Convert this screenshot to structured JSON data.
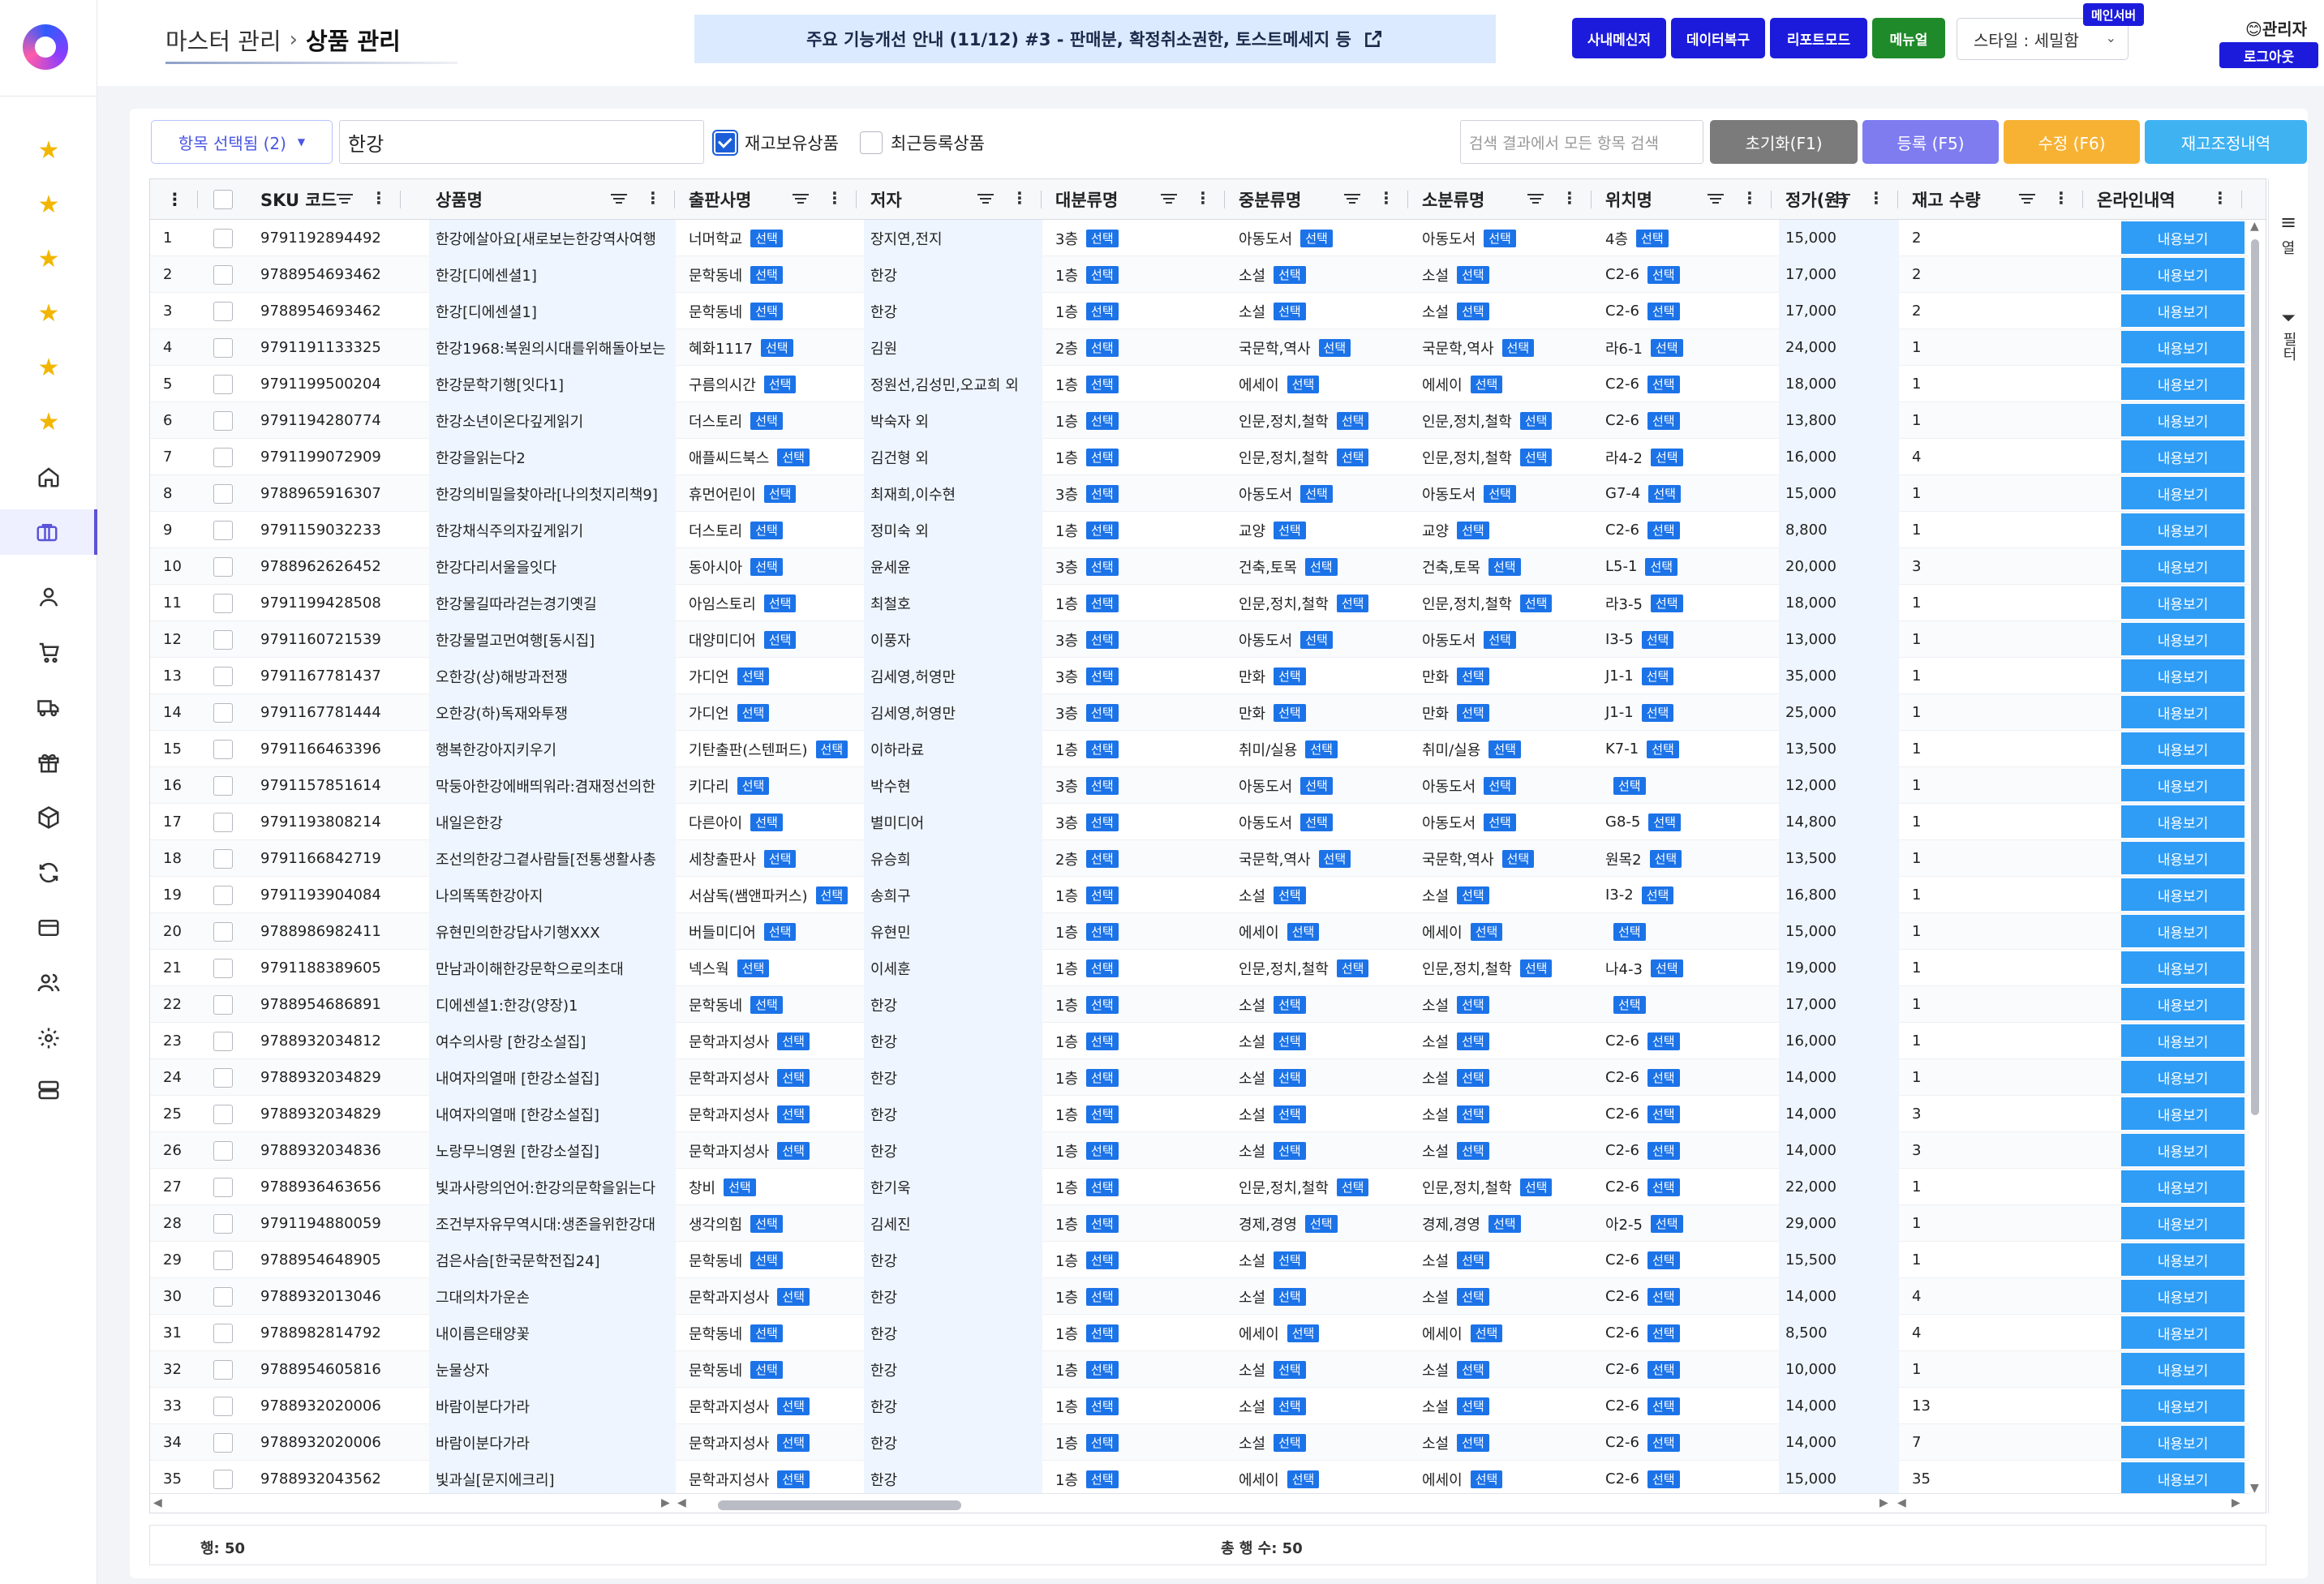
{
  "header": {
    "breadcrumb_parent": "마스터 관리",
    "breadcrumb_current": "상품 관리",
    "notice": "주요 기능개선 안내 (11/12) #3 - 판매분, 확정취소권한, 토스트메세지 등",
    "buttons": {
      "messenger": "사내메신저",
      "data_restore": "데이터복구",
      "report_mode": "리포트모드",
      "manual": "메뉴얼"
    },
    "style_select": "스타일 : 세밀함",
    "server_badge": "메인서버",
    "user": "😊관리자",
    "logout": "로그아웃"
  },
  "toolbar": {
    "column_select": "항목 선택됨 (2)",
    "search_value": "한강",
    "in_stock_label": "재고보유상품",
    "in_stock_checked": true,
    "recent_label": "최근등록상품",
    "recent_checked": false,
    "search_all_placeholder": "검색 결과에서 모든 항목 검색",
    "reset": "초기화(F1)",
    "register": "등록 (F5)",
    "edit": "수정 (F6)",
    "stock_history": "재고조정내역"
  },
  "colors": {
    "reset": "#7b7b7b",
    "register": "#7f7cf0",
    "edit": "#f7b234",
    "stock_history": "#3fb2f2",
    "select_badge": "#1c73e8",
    "view_button": "#2f9df5"
  },
  "columns": [
    "SKU 코드",
    "상품명",
    "출판사명",
    "저자",
    "대분류명",
    "중분류명",
    "소분류명",
    "위치명",
    "정가(원)",
    "재고 수량",
    "온라인내역"
  ],
  "select_label": "선택",
  "view_label": "내용보기",
  "rows": [
    [
      "1",
      "9791192894492",
      "한강에살아요[새로보는한강역사여행",
      "너머학교",
      "장지연,전지",
      "3층",
      "아동도서",
      "아동도서",
      "4층",
      "15,000",
      "2"
    ],
    [
      "2",
      "9788954693462",
      "한강[디에센셜1]",
      "문학동네",
      "한강",
      "1층",
      "소설",
      "소설",
      "C2-6",
      "17,000",
      "2"
    ],
    [
      "3",
      "9788954693462",
      "한강[디에센셜1]",
      "문학동네",
      "한강",
      "1층",
      "소설",
      "소설",
      "C2-6",
      "17,000",
      "2"
    ],
    [
      "4",
      "9791191133325",
      "한강1968:복원의시대를위해돌아보는",
      "혜화1117",
      "김원",
      "2층",
      "국문학,역사",
      "국문학,역사",
      "라6-1",
      "24,000",
      "1"
    ],
    [
      "5",
      "9791199500204",
      "한강문학기행[잇다1]",
      "구름의시간",
      "정원선,김성민,오교희 외",
      "1층",
      "에세이",
      "에세이",
      "C2-6",
      "18,000",
      "1"
    ],
    [
      "6",
      "9791194280774",
      "한강소년이온다깊게읽기",
      "더스토리",
      "박숙자 외",
      "1층",
      "인문,정치,철학",
      "인문,정치,철학",
      "C2-6",
      "13,800",
      "1"
    ],
    [
      "7",
      "9791199072909",
      "한강을읽는다2",
      "애플씨드북스",
      "김건형 외",
      "1층",
      "인문,정치,철학",
      "인문,정치,철학",
      "라4-2",
      "16,000",
      "4"
    ],
    [
      "8",
      "9788965916307",
      "한강의비밀을찾아라[나의첫지리책9]",
      "휴먼어린이",
      "최재희,이수현",
      "3층",
      "아동도서",
      "아동도서",
      "G7-4",
      "15,000",
      "1"
    ],
    [
      "9",
      "9791159032233",
      "한강채식주의자깊게읽기",
      "더스토리",
      "정미숙 외",
      "1층",
      "교양",
      "교양",
      "C2-6",
      "8,800",
      "1"
    ],
    [
      "10",
      "9788962626452",
      "한강다리서울을잇다",
      "동아시아",
      "윤세윤",
      "3층",
      "건축,토목",
      "건축,토목",
      "L5-1",
      "20,000",
      "3"
    ],
    [
      "11",
      "9791199428508",
      "한강물길따라걷는경기옛길",
      "아임스토리",
      "최철호",
      "1층",
      "인문,정치,철학",
      "인문,정치,철학",
      "라3-5",
      "18,000",
      "1"
    ],
    [
      "12",
      "9791160721539",
      "한강물멀고먼여행[동시집]",
      "대양미디어",
      "이풍자",
      "3층",
      "아동도서",
      "아동도서",
      "I3-5",
      "13,000",
      "1"
    ],
    [
      "13",
      "9791167781437",
      "오한강(상)해방과전쟁",
      "가디언",
      "김세영,허영만",
      "3층",
      "만화",
      "만화",
      "J1-1",
      "35,000",
      "1"
    ],
    [
      "14",
      "9791167781444",
      "오한강(하)독재와투쟁",
      "가디언",
      "김세영,허영만",
      "3층",
      "만화",
      "만화",
      "J1-1",
      "25,000",
      "1"
    ],
    [
      "15",
      "9791166463396",
      "행복한강아지키우기",
      "기탄출판(스텐퍼드)",
      "이하라료",
      "1층",
      "취미/실용",
      "취미/실용",
      "K7-1",
      "13,500",
      "1"
    ],
    [
      "16",
      "9791157851614",
      "막둥아한강에배띄워라:겸재정선의한",
      "키다리",
      "박수현",
      "3층",
      "아동도서",
      "아동도서",
      "",
      "12,000",
      "1"
    ],
    [
      "17",
      "9791193808214",
      "내일은한강",
      "다른아이",
      "별미디어",
      "3층",
      "아동도서",
      "아동도서",
      "G8-5",
      "14,800",
      "1"
    ],
    [
      "18",
      "9791166842719",
      "조선의한강그곁사람들[전통생활사총",
      "세창출판사",
      "유승희",
      "2층",
      "국문학,역사",
      "국문학,역사",
      "원목2",
      "13,500",
      "1"
    ],
    [
      "19",
      "9791193904084",
      "나의똑똑한강아지",
      "서삼독(쌤앤파커스)",
      "송희구",
      "1층",
      "소설",
      "소설",
      "I3-2",
      "16,800",
      "1"
    ],
    [
      "20",
      "9788986982411",
      "유현민의한강답사기행XXX",
      "버들미디어",
      "유현민",
      "1층",
      "에세이",
      "에세이",
      "",
      "15,000",
      "1"
    ],
    [
      "21",
      "9791188389605",
      "만남과이해한강문학으로의초대",
      "넥스웍",
      "이세훈",
      "1층",
      "인문,정치,철학",
      "인문,정치,철학",
      "나4-3",
      "19,000",
      "1"
    ],
    [
      "22",
      "9788954686891",
      "디에센셜1:한강(양장)1",
      "문학동네",
      "한강",
      "1층",
      "소설",
      "소설",
      "",
      "17,000",
      "1"
    ],
    [
      "23",
      "9788932034812",
      "여수의사랑 [한강소설집]",
      "문학과지성사",
      "한강",
      "1층",
      "소설",
      "소설",
      "C2-6",
      "16,000",
      "1"
    ],
    [
      "24",
      "9788932034829",
      "내여자의열매 [한강소설집]",
      "문학과지성사",
      "한강",
      "1층",
      "소설",
      "소설",
      "C2-6",
      "14,000",
      "1"
    ],
    [
      "25",
      "9788932034829",
      "내여자의열매 [한강소설집]",
      "문학과지성사",
      "한강",
      "1층",
      "소설",
      "소설",
      "C2-6",
      "14,000",
      "3"
    ],
    [
      "26",
      "9788932034836",
      "노랑무늬영원 [한강소설집]",
      "문학과지성사",
      "한강",
      "1층",
      "소설",
      "소설",
      "C2-6",
      "14,000",
      "3"
    ],
    [
      "27",
      "9788936463656",
      "빛과사랑의언어:한강의문학을읽는다",
      "창비",
      "한기욱",
      "1층",
      "인문,정치,철학",
      "인문,정치,철학",
      "C2-6",
      "22,000",
      "1"
    ],
    [
      "28",
      "9791194880059",
      "조건부자유무역시대:생존을위한강대",
      "생각의힘",
      "김세진",
      "1층",
      "경제,경영",
      "경제,경영",
      "아2-5",
      "29,000",
      "1"
    ],
    [
      "29",
      "9788954648905",
      "검은사슴[한국문학전집24]",
      "문학동네",
      "한강",
      "1층",
      "소설",
      "소설",
      "C2-6",
      "15,500",
      "1"
    ],
    [
      "30",
      "9788932013046",
      "그대의차가운손",
      "문학과지성사",
      "한강",
      "1층",
      "소설",
      "소설",
      "C2-6",
      "14,000",
      "4"
    ],
    [
      "31",
      "9788982814792",
      "내이름은태양꽃",
      "문학동네",
      "한강",
      "1층",
      "에세이",
      "에세이",
      "C2-6",
      "8,500",
      "4"
    ],
    [
      "32",
      "9788954605816",
      "눈물상자",
      "문학동네",
      "한강",
      "1층",
      "소설",
      "소설",
      "C2-6",
      "10,000",
      "1"
    ],
    [
      "33",
      "9788932020006",
      "바람이분다가라",
      "문학과지성사",
      "한강",
      "1층",
      "소설",
      "소설",
      "C2-6",
      "14,000",
      "13"
    ],
    [
      "34",
      "9788932020006",
      "바람이분다가라",
      "문학과지성사",
      "한강",
      "1층",
      "소설",
      "소설",
      "C2-6",
      "14,000",
      "7"
    ],
    [
      "35",
      "9788932043562",
      "빛과실[문지에크리]",
      "문학과지성사",
      "한강",
      "1층",
      "에세이",
      "에세이",
      "C2-6",
      "15,000",
      "35"
    ]
  ],
  "side_tools": {
    "columns": "열",
    "filters": "필터"
  },
  "footer": {
    "rows": "행: 50",
    "total": "총 행 수: 50"
  }
}
